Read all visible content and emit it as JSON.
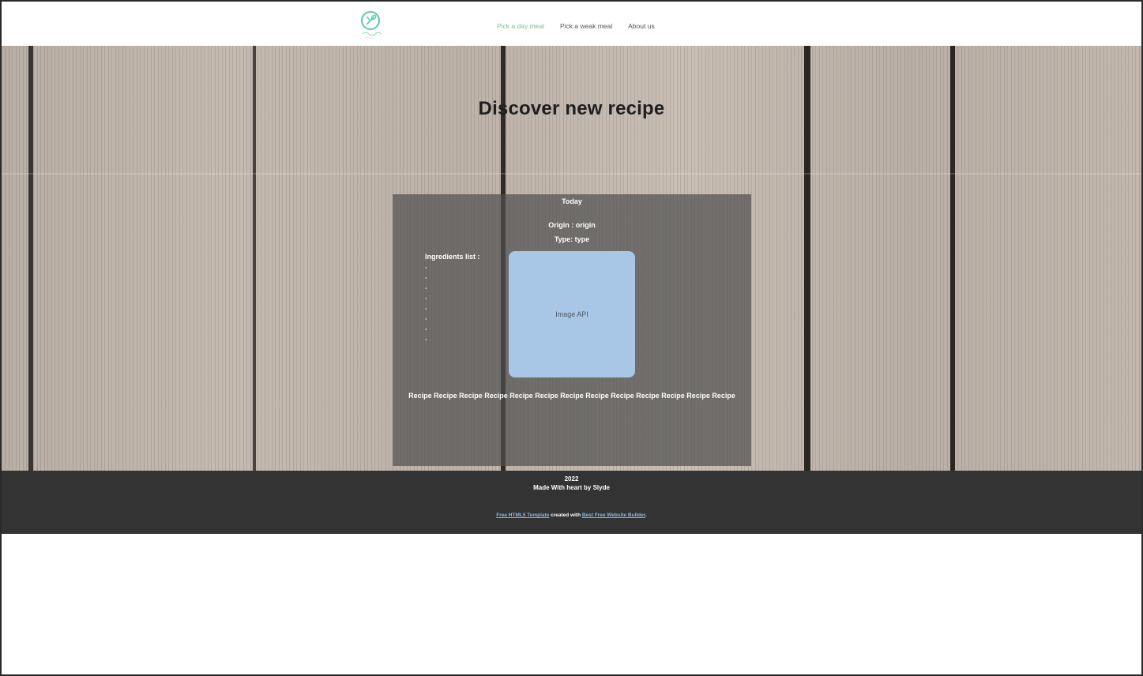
{
  "nav": {
    "items": [
      {
        "label": "Pick a day meal",
        "active": true
      },
      {
        "label": "Pick a weak meal",
        "active": false
      },
      {
        "label": "About us",
        "active": false
      }
    ],
    "active_color": "#7cbf8e"
  },
  "hero": {
    "title": "Discover new recipe"
  },
  "card": {
    "day": "Today",
    "origin": "Origin : origin",
    "type": "Type: type",
    "ingredients_label": "Ingredients list :",
    "ingredients": [
      "-",
      "-",
      "-",
      "-",
      "-",
      "-",
      "-",
      "-"
    ],
    "image_placeholder": "Image API",
    "image_color": "#a8c6e6",
    "recipe_text": "Recipe Recipe Recipe Recipe Recipe Recipe Recipe Recipe Recipe Recipe Recipe Recipe Recipe"
  },
  "footer": {
    "year": "2022",
    "made_with": "Made With heart by Slyde",
    "credit_link_1": "Free HTML5 Template",
    "credit_mid": " created with ",
    "credit_link_2": "Best Free Website Builder",
    "credit_end": ".",
    "link_color": "#8fb4e0"
  }
}
